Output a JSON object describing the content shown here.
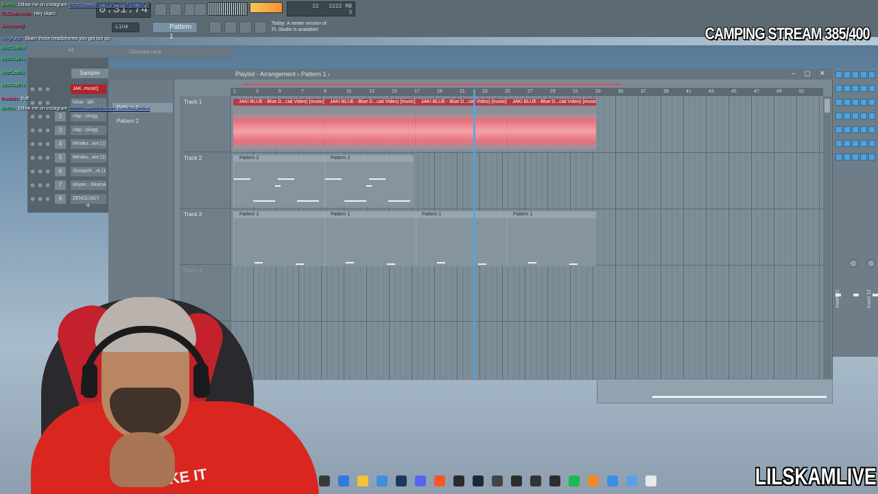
{
  "toolbar": {
    "time": "0:31:74",
    "mode": "Line",
    "pattern": "Pattern 1",
    "cpu": "22",
    "memory": "2222 MB",
    "polyphony": "3",
    "hint_line1": "Today: A newer version of",
    "hint_line2": "FL Studio is available!"
  },
  "overlay": {
    "stream_title": "CAMPING STREAM 385/400",
    "brand": "LILSKAMLIVE"
  },
  "chat": [
    {
      "user": "BotRix",
      "text": ": follow me on instagram ",
      "link": "https://www.instagram.com/lilskamlive",
      "cls": "u1"
    },
    {
      "user": "FLChainoMan",
      "text": ": Hey skam",
      "link": "",
      "cls": "u2"
    },
    {
      "user": "Jakonsenji",
      "text": "",
      "link": "",
      "cls": "u2"
    },
    {
      "user": "KingKage",
      "text": ": Skam those headphones you got too op",
      "link": "",
      "cls": "u3"
    },
    {
      "user": "MistGodRx",
      "text": "",
      "link": "",
      "cls": "u1"
    },
    {
      "user": "MistGodRx",
      "text": "",
      "link": "",
      "cls": "u1"
    },
    {
      "user": "MistGodRx",
      "text": "",
      "link": "",
      "cls": "u1"
    },
    {
      "user": "MistGodRx",
      "text": "",
      "link": "",
      "cls": "u1"
    },
    {
      "user": "Inoshiro",
      "text": ": fluff",
      "link": "",
      "cls": "u2"
    },
    {
      "user": "BotRix",
      "text": ": follow me on instagram ",
      "link": "https://www.instagram.com/lilskamlive",
      "cls": "u1"
    }
  ],
  "channel_rack": {
    "title": "Channel rack",
    "sampler": "Sampler",
    "all": "All",
    "channels": [
      {
        "num": "",
        "name": "JAK..music]",
        "red": true
      },
      {
        "num": "",
        "name": "hihat - bih",
        "red": false
      },
      {
        "num": "2",
        "name": "clap - plugg",
        "red": false
      },
      {
        "num": "3",
        "name": "clap - plugg",
        "red": false
      },
      {
        "num": "4",
        "name": "Mexiko...ant (1)",
        "red": false
      },
      {
        "num": "5",
        "name": "Mexiko...are (1)",
        "red": false
      },
      {
        "num": "6",
        "name": "StoopidX...rk (1)",
        "red": false
      },
      {
        "num": "7",
        "name": "olopec...lskama",
        "red": false
      },
      {
        "num": "8",
        "name": "ZENOLOGY",
        "red": false
      }
    ],
    "add_label": "+"
  },
  "playlist": {
    "title": "Playlist - Arrangement",
    "pattern": "Pattern 1",
    "picker": [
      "Pattern 1",
      "Pattern 2"
    ],
    "tracks": [
      "Track 1",
      "Track 2",
      "Track 3",
      "Track 4"
    ],
    "ruler": [
      "1",
      "3",
      "5",
      "7",
      "9",
      "11",
      "13",
      "15",
      "17",
      "19",
      "21",
      "23",
      "25",
      "27",
      "29",
      "31",
      "33",
      "35",
      "37",
      "39",
      "41",
      "43",
      "45",
      "47",
      "49",
      "51"
    ],
    "audio_clips": [
      "JAKI BLUE - Blue D...cial Video) [music]",
      "JAKI BLUE - Blue D...cial Video) [music]",
      "JAKI BLUE - Blue D...cial Video) [music]",
      "JAKI BLUE - Blue D...cial Video) [music]"
    ],
    "track2_clips": [
      "Pattern 2",
      "Pattern 2"
    ],
    "track3_clips": [
      "Pattern 1",
      "Pattern 1",
      "Pattern 1",
      "Pattern 1"
    ]
  },
  "mixer": {
    "inserts": [
      "Insert 11",
      "Insert 12"
    ]
  },
  "cam": {
    "hoodie_text": "AKE IT"
  },
  "colors": {
    "accent_blue": "#4aa8e8",
    "audio_clip": "#b13a46",
    "wave": "#e8646f",
    "selection": "#e24a5b"
  }
}
